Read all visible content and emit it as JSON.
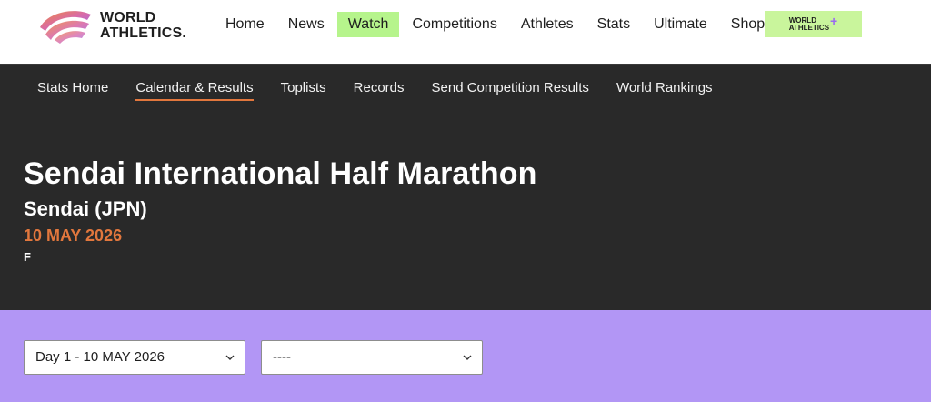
{
  "header": {
    "logo_line1": "WORLD",
    "logo_line2": "ATHLETICS.",
    "nav": [
      {
        "label": "Home"
      },
      {
        "label": "News"
      },
      {
        "label": "Watch"
      },
      {
        "label": "Competitions"
      },
      {
        "label": "Athletes"
      },
      {
        "label": "Stats"
      },
      {
        "label": "Ultimate"
      },
      {
        "label": "Shop"
      }
    ],
    "active_nav": "Watch",
    "plus_line1": "WORLD",
    "plus_line2": "ATHLETICS",
    "plus_symbol": "+"
  },
  "stats_nav": {
    "items": [
      {
        "label": "Stats Home"
      },
      {
        "label": "Calendar & Results"
      },
      {
        "label": "Toplists"
      },
      {
        "label": "Records"
      },
      {
        "label": "Send Competition Results"
      },
      {
        "label": "World Rankings"
      }
    ],
    "active": "Calendar & Results"
  },
  "competition": {
    "name": "Sendai International Half Marathon",
    "venue": "Sendai (JPN)",
    "date": "10 MAY 2026",
    "category": "F"
  },
  "filters": {
    "day_select": "Day 1 - 10 MAY 2026",
    "event_select": "----"
  },
  "colors": {
    "accent_orange": "#e2773d",
    "watch_green": "#b6f48c",
    "filter_purple": "#b296f5",
    "dark_bg": "#292929"
  }
}
